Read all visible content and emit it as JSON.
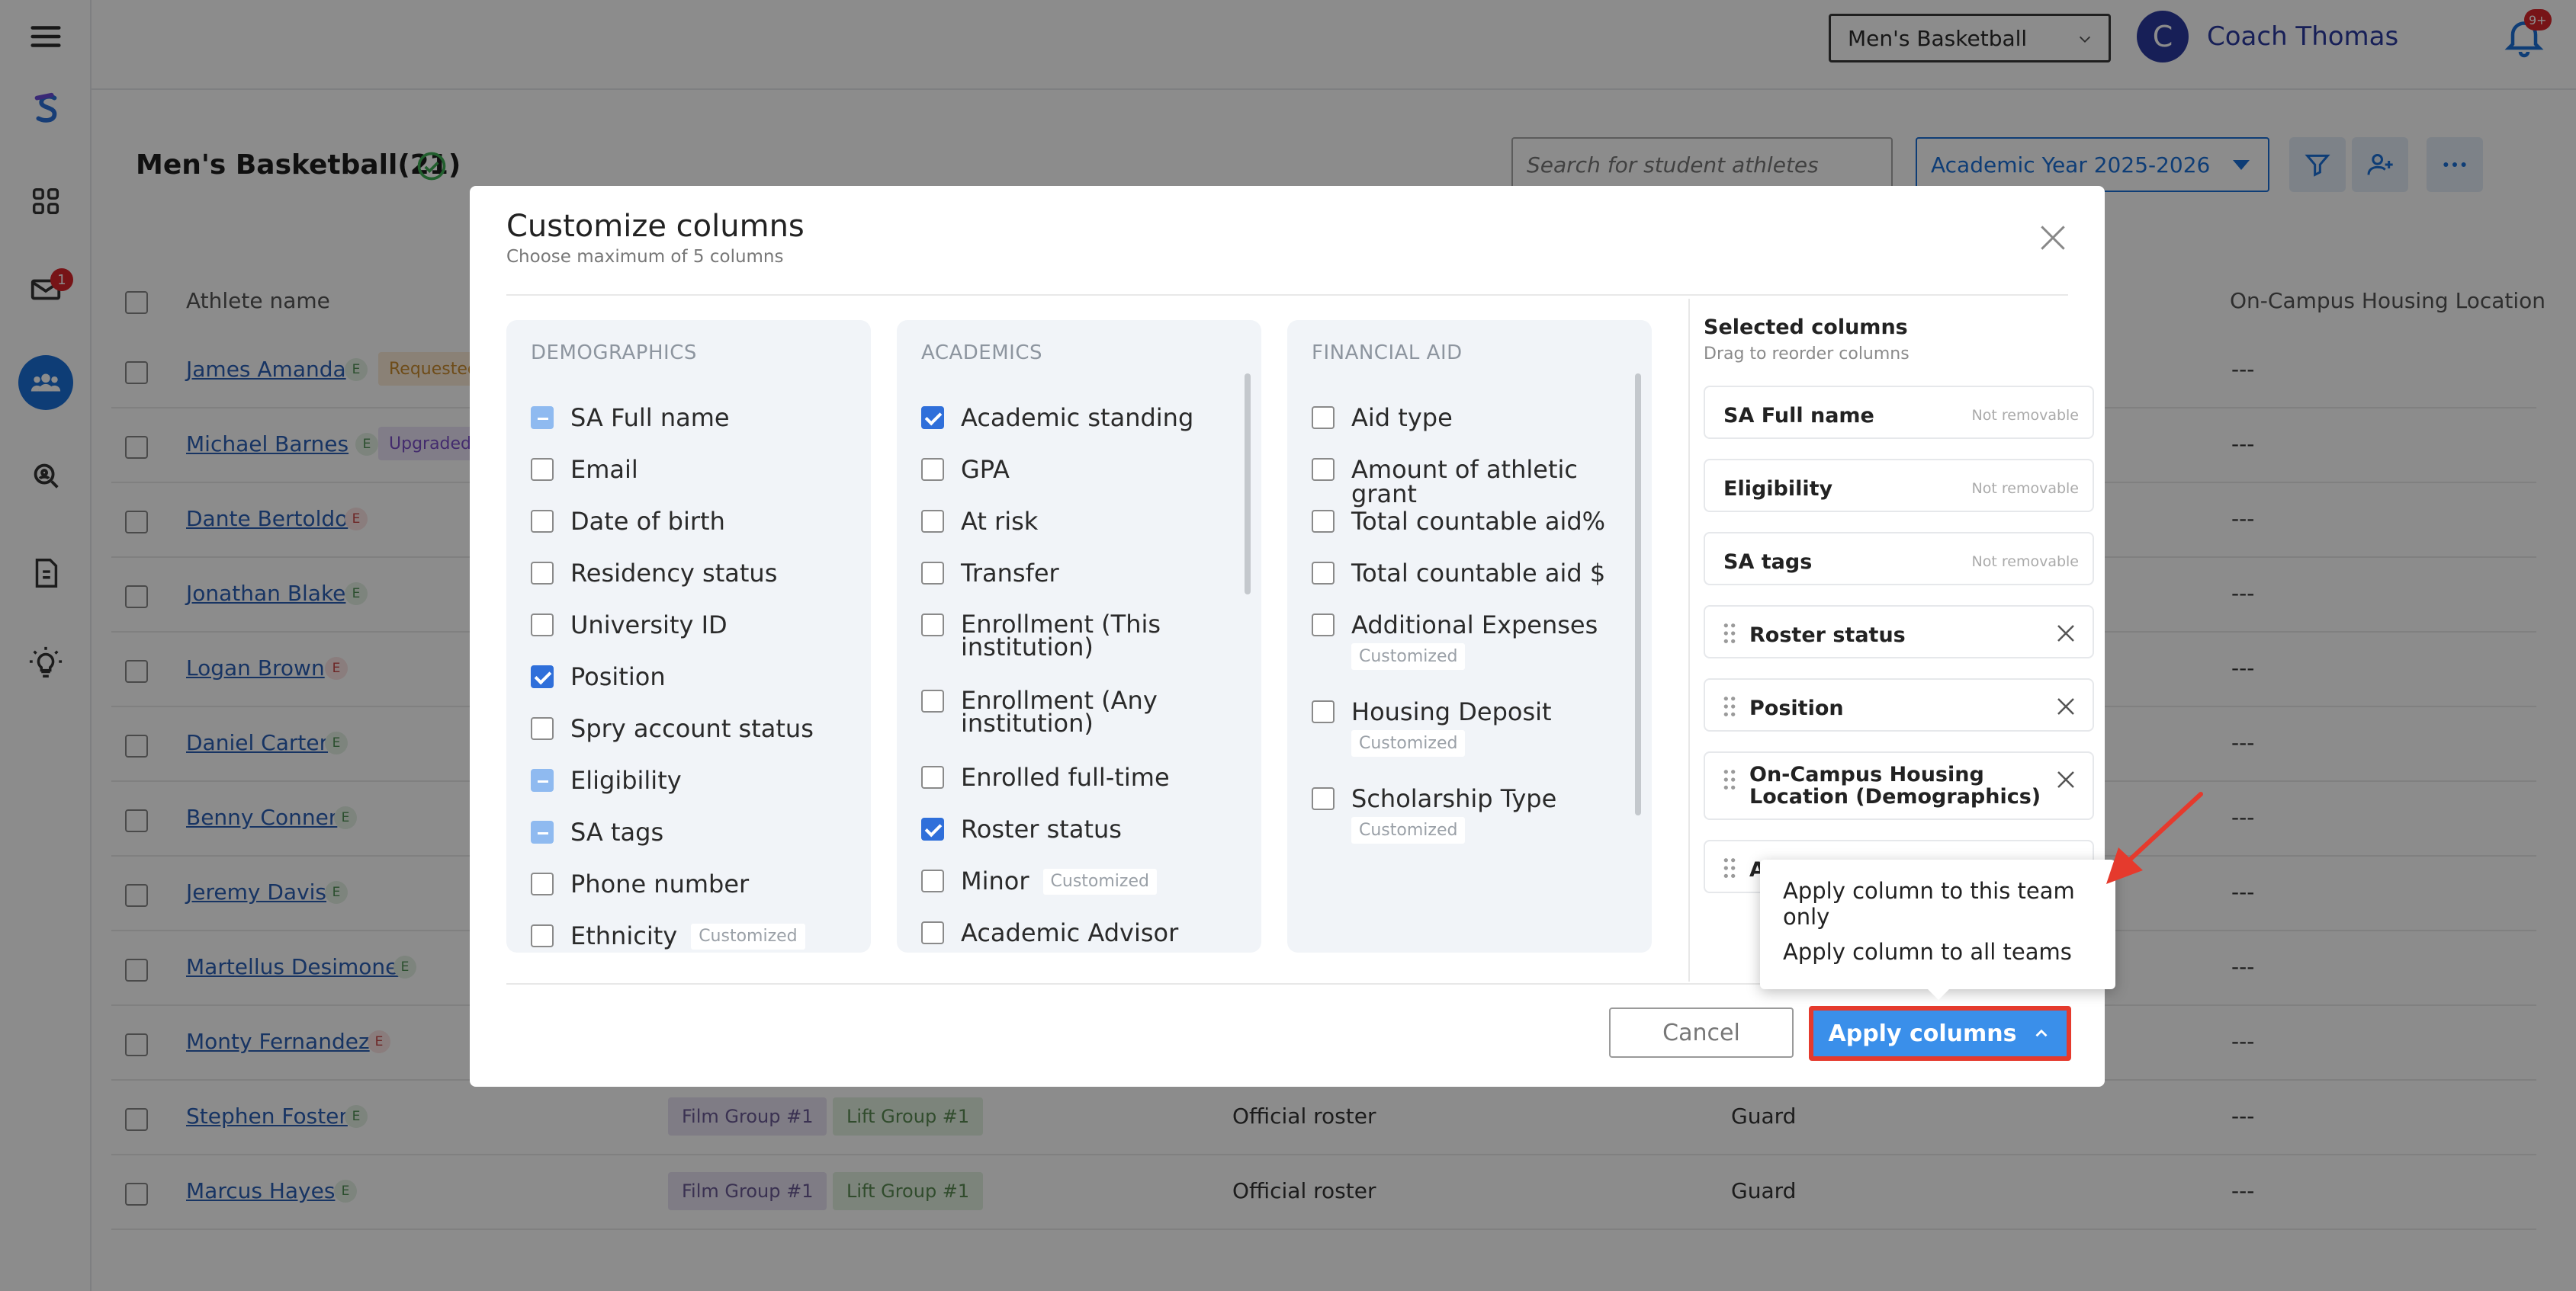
{
  "app": {
    "team_select": "Men's Basketball",
    "coach_initial": "C",
    "coach_name": "Coach Thomas",
    "notifications_badge": "9+",
    "mail_badge": "1",
    "accent": "#1b6fd8"
  },
  "page": {
    "title": "Men's Basketball(21)",
    "search_placeholder": "Search for student athletes",
    "academic_year": "Academic Year 2025-2026"
  },
  "table": {
    "headers": {
      "athlete_name": "Athlete name",
      "housing": "On-Campus Housing Location"
    },
    "rows": [
      {
        "name": "James Amanda",
        "badge": "E",
        "status": "Requested",
        "dash": "---"
      },
      {
        "name": "Michael Barnes",
        "badge": "E",
        "status": "Upgraded f",
        "dash": "---"
      },
      {
        "name": "Dante Bertoldo",
        "badge": "E",
        "dash": "---"
      },
      {
        "name": "Jonathan Blake",
        "badge": "E",
        "dash": "---"
      },
      {
        "name": "Logan Brown",
        "badge": "E",
        "dash": "---"
      },
      {
        "name": "Daniel Carter",
        "badge": "E",
        "dash": "---"
      },
      {
        "name": "Benny Conner",
        "badge": "E",
        "dash": "---"
      },
      {
        "name": "Jeremy Davis",
        "badge": "E",
        "dash": "---"
      },
      {
        "name": "Martellus Desimone",
        "badge": "E",
        "dash": "---"
      },
      {
        "name": "Monty Fernandez",
        "badge": "E",
        "dash": "---"
      },
      {
        "name": "Stephen Foster",
        "badge": "E",
        "tag1": "Film Group #1",
        "tag2": "Lift Group #1",
        "roster": "Official roster",
        "position": "Guard",
        "dash": "---"
      },
      {
        "name": "Marcus Hayes",
        "badge": "E",
        "tag1": "Film Group #1",
        "tag2": "Lift Group #1",
        "roster": "Official roster",
        "position": "Guard",
        "dash": "---"
      }
    ]
  },
  "modal": {
    "title": "Customize columns",
    "subtitle": "Choose maximum of 5 columns",
    "demographics": {
      "title": "DEMOGRAPHICS",
      "items": [
        {
          "label": "SA Full name",
          "state": "locked"
        },
        {
          "label": "Email",
          "state": "unchecked"
        },
        {
          "label": "Date of birth",
          "state": "unchecked"
        },
        {
          "label": "Residency status",
          "state": "unchecked"
        },
        {
          "label": "University ID",
          "state": "unchecked"
        },
        {
          "label": "Position",
          "state": "checked"
        },
        {
          "label": "Spry account status",
          "state": "unchecked"
        },
        {
          "label": "Eligibility",
          "state": "locked"
        },
        {
          "label": "SA tags",
          "state": "locked"
        },
        {
          "label": "Phone number",
          "state": "unchecked"
        },
        {
          "label": "Ethnicity",
          "state": "unchecked",
          "badge": "Customized"
        }
      ]
    },
    "academics": {
      "title": "ACADEMICS",
      "items": [
        {
          "label": "Academic standing",
          "state": "checked"
        },
        {
          "label": "GPA",
          "state": "unchecked"
        },
        {
          "label": "At risk",
          "state": "unchecked"
        },
        {
          "label": "Transfer",
          "state": "unchecked"
        },
        {
          "label": "Enrollment (This institution)",
          "state": "unchecked"
        },
        {
          "label": "Enrollment (Any institution)",
          "state": "unchecked"
        },
        {
          "label": "Enrolled full-time",
          "state": "unchecked"
        },
        {
          "label": "Roster status",
          "state": "checked"
        },
        {
          "label": "Minor",
          "state": "unchecked",
          "badge": "Customized"
        },
        {
          "label": "Academic Advisor",
          "state": "unchecked"
        }
      ]
    },
    "financial_aid": {
      "title": "FINANCIAL AID",
      "items": [
        {
          "label": "Aid type",
          "state": "unchecked"
        },
        {
          "label": "Amount of athletic grant",
          "state": "unchecked"
        },
        {
          "label": "Total countable aid%",
          "state": "unchecked"
        },
        {
          "label": "Total countable aid $",
          "state": "unchecked"
        },
        {
          "label": "Additional Expenses",
          "state": "unchecked",
          "badge": "Customized"
        },
        {
          "label": "Housing Deposit",
          "state": "unchecked",
          "badge": "Customized"
        },
        {
          "label": "Scholarship Type",
          "state": "unchecked",
          "badge": "Customized"
        }
      ]
    },
    "selected": {
      "title": "Selected columns",
      "subtitle": "Drag to reorder columns",
      "not_removable": "Not removable",
      "items": [
        {
          "label": "SA Full name",
          "removable": false
        },
        {
          "label": "Eligibility",
          "removable": false
        },
        {
          "label": "SA tags",
          "removable": false
        },
        {
          "label": "Roster status",
          "removable": true
        },
        {
          "label": "Position",
          "removable": true
        },
        {
          "label": "On-Campus Housing Location (Demographics)",
          "removable": true
        },
        {
          "label": "A",
          "removable": true
        }
      ]
    },
    "cancel_label": "Cancel",
    "apply_label": "Apply columns",
    "apply_menu": {
      "team_only": "Apply column to this team only",
      "all_teams": "Apply column to all teams"
    },
    "checkbox_color": "#2f6fda",
    "highlight_color": "#e53a2d"
  }
}
